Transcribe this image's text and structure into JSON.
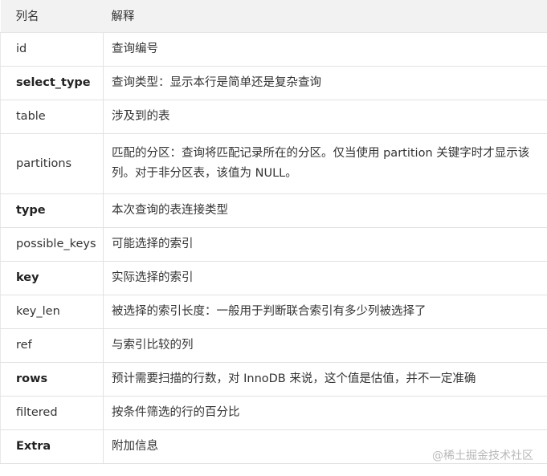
{
  "table": {
    "headers": {
      "name": "列名",
      "description": "解释"
    },
    "rows": [
      {
        "name": "id",
        "description": "查询编号",
        "bold": false
      },
      {
        "name": "select_type",
        "description": "查询类型：显示本行是简单还是复杂查询",
        "bold": true
      },
      {
        "name": "table",
        "description": "涉及到的表",
        "bold": false
      },
      {
        "name": "partitions",
        "description": "匹配的分区：查询将匹配记录所在的分区。仅当使用 partition 关键字时才显示该列。对于非分区表，该值为 NULL。",
        "bold": false
      },
      {
        "name": "type",
        "description": "本次查询的表连接类型",
        "bold": true
      },
      {
        "name": "possible_keys",
        "description": "可能选择的索引",
        "bold": false
      },
      {
        "name": "key",
        "description": "实际选择的索引",
        "bold": true
      },
      {
        "name": "key_len",
        "description": "被选择的索引长度：一般用于判断联合索引有多少列被选择了",
        "bold": false
      },
      {
        "name": "ref",
        "description": "与索引比较的列",
        "bold": false
      },
      {
        "name": "rows",
        "description": "预计需要扫描的行数，对 InnoDB 来说，这个值是估值，并不一定准确",
        "bold": true
      },
      {
        "name": "filtered",
        "description": "按条件筛选的行的百分比",
        "bold": false
      },
      {
        "name": "Extra",
        "description": "附加信息",
        "bold": true
      }
    ]
  },
  "watermark": "@稀土掘金技术社区"
}
